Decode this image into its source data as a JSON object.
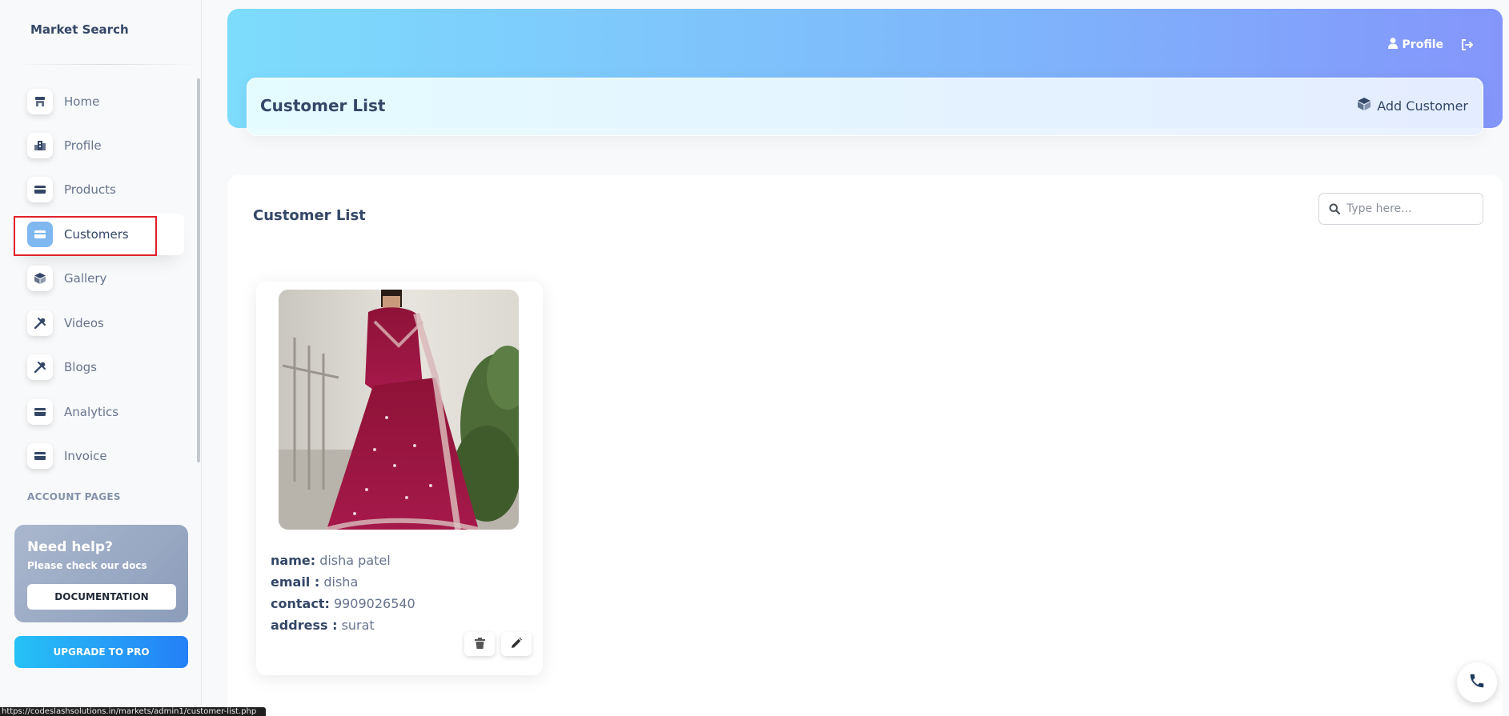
{
  "brand": "Market Search",
  "sidebar": {
    "items": [
      {
        "label": "Home",
        "icon": "shop-icon",
        "active": false
      },
      {
        "label": "Profile",
        "icon": "office-icon",
        "active": false
      },
      {
        "label": "Products",
        "icon": "credit-card-icon",
        "active": false
      },
      {
        "label": "Customers",
        "icon": "credit-card-icon",
        "active": true
      },
      {
        "label": "Gallery",
        "icon": "box-icon",
        "active": false
      },
      {
        "label": "Videos",
        "icon": "tools-icon",
        "active": false
      },
      {
        "label": "Blogs",
        "icon": "tools-icon",
        "active": false
      },
      {
        "label": "Analytics",
        "icon": "credit-card-icon",
        "active": false
      },
      {
        "label": "Invoice",
        "icon": "credit-card-icon",
        "active": false
      }
    ],
    "section_title": "ACCOUNT PAGES",
    "help": {
      "title": "Need help?",
      "subtitle": "Please check our docs",
      "button": "DOCUMENTATION"
    },
    "upgrade_button": "UPGRADE TO PRO"
  },
  "header": {
    "profile_label": "Profile",
    "title": "Customer List",
    "add_button": "Add Customer"
  },
  "main": {
    "title": "Customer List",
    "search_placeholder": "Type here..."
  },
  "customers": [
    {
      "name_label": "name:",
      "name": "disha patel",
      "email_label": "email :",
      "email": "disha",
      "contact_label": "contact:",
      "contact": "9909026540",
      "address_label": "address :",
      "address": "surat"
    }
  ],
  "status_url": "https://codeslashsolutions.in/markets/admin1/customer-list.php",
  "colors": {
    "accent": "#7fb7f0",
    "header_gradient_start": "#7ddcfc",
    "header_gradient_end": "#8496fb",
    "highlight": "#e0202b",
    "dress": "#9b1540"
  }
}
